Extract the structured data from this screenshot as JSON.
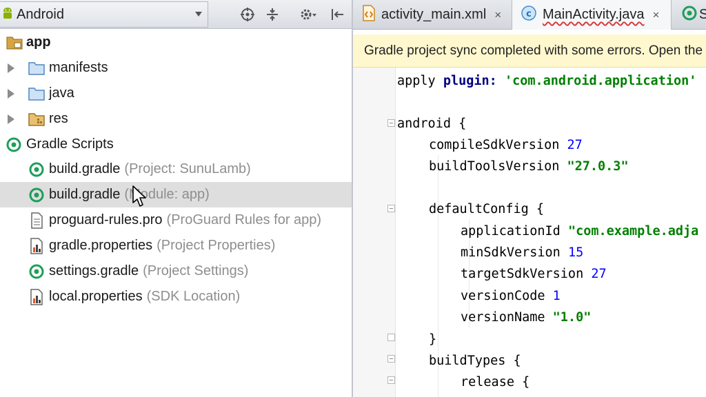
{
  "project_panel": {
    "view_selector": {
      "label": "Android"
    },
    "toolbar_icons": [
      "locate-icon",
      "collapse-all-icon",
      "settings-gear-icon",
      "hide-panel-icon"
    ],
    "tree": [
      {
        "name": "app",
        "hint": "",
        "icon": "module-folder-icon",
        "bold": true
      },
      {
        "name": "manifests",
        "hint": "",
        "icon": "folder-icon"
      },
      {
        "name": "java",
        "hint": "",
        "icon": "folder-icon"
      },
      {
        "name": "res",
        "hint": "",
        "icon": "res-folder-icon"
      },
      {
        "name": "Gradle Scripts",
        "hint": "",
        "icon": "gradle-icon"
      },
      {
        "name": "build.gradle",
        "hint": "(Project: SunuLamb)",
        "icon": "gradle-icon"
      },
      {
        "name": "build.gradle",
        "hint": "(Module: app)",
        "icon": "gradle-icon",
        "selected": true
      },
      {
        "name": "proguard-rules.pro",
        "hint": "(ProGuard Rules for app)",
        "icon": "text-file-icon"
      },
      {
        "name": "gradle.properties",
        "hint": "(Project Properties)",
        "icon": "properties-icon"
      },
      {
        "name": "settings.gradle",
        "hint": "(Project Settings)",
        "icon": "gradle-icon"
      },
      {
        "name": "local.properties",
        "hint": "(SDK Location)",
        "icon": "properties-icon"
      }
    ]
  },
  "editor": {
    "tabs": [
      {
        "label": "activity_main.xml",
        "close": "×",
        "icon": "xml-file-icon"
      },
      {
        "label": "MainActivity.java",
        "close": "×",
        "icon": "java-class-icon"
      },
      {
        "label": "S",
        "icon": "gradle-icon"
      }
    ],
    "notification": "Gradle project sync completed with some errors. Open the",
    "code_lines": [
      [
        "apply ",
        "plugin: ",
        "'com.android.application'"
      ],
      [
        "android {"
      ],
      [
        "compileSdkVersion ",
        "27"
      ],
      [
        "buildToolsVersion ",
        "\"27.0.3\""
      ],
      [
        "defaultConfig {"
      ],
      [
        "applicationId ",
        "\"com.example.adja"
      ],
      [
        "minSdkVersion ",
        "15"
      ],
      [
        "targetSdkVersion ",
        "27"
      ],
      [
        "versionCode ",
        "1"
      ],
      [
        "versionName ",
        "\"1.0\""
      ],
      [
        "}"
      ],
      [
        "buildTypes {"
      ],
      [
        "release {"
      ]
    ]
  },
  "colors": {
    "selection": "#dedede",
    "hint_text": "#8e8e8e",
    "string": "#008000",
    "number": "#0000ff",
    "keyword": "#000080",
    "notification_bg": "#fff8cf"
  }
}
